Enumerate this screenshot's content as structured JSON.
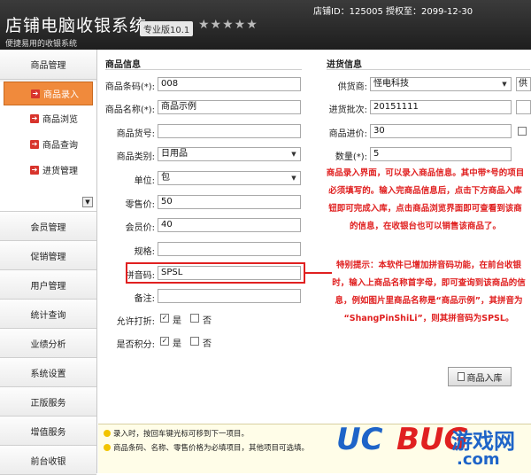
{
  "header": {
    "title": "店铺电脑收银系统",
    "subtitle": "便捷易用的收银系统",
    "edition": "专业版10.1",
    "stars": "★★★★★",
    "shop_info": "店铺ID：125005 授权至：2099-12-30"
  },
  "sidebar": {
    "groups": [
      "商品管理",
      "会员管理",
      "促销管理",
      "用户管理",
      "统计查询",
      "业绩分析",
      "系统设置",
      "正版服务",
      "增值服务",
      "前台收银"
    ],
    "sub_items": [
      "商品录入",
      "商品浏览",
      "商品查询",
      "进货管理"
    ]
  },
  "product_info": {
    "title": "商品信息",
    "fields": [
      {
        "label": "商品条码(*):",
        "value": "008"
      },
      {
        "label": "商品名称(*):",
        "value": "商品示例"
      },
      {
        "label": "商品货号:",
        "value": ""
      },
      {
        "label": "商品类别:",
        "value": "日用品"
      },
      {
        "label": "单位:",
        "value": "包"
      },
      {
        "label": "零售价:",
        "value": "50"
      },
      {
        "label": "会员价:",
        "value": "40"
      },
      {
        "label": "规格:",
        "value": ""
      },
      {
        "label": "拼音码:",
        "value": "SPSL"
      },
      {
        "label": "备注:",
        "value": ""
      }
    ],
    "allow_discount_label": "允许打折:",
    "allow_points_label": "是否积分:",
    "yes": "是",
    "no": "否"
  },
  "purchase_info": {
    "title": "进货信息",
    "fields": [
      {
        "label": "供货商:",
        "value": "怪电科技"
      },
      {
        "label": "进货批次:",
        "value": "20151111"
      },
      {
        "label": "商品进价:",
        "value": "30"
      },
      {
        "label": "数量(*):",
        "value": "5"
      }
    ],
    "side_button": "供"
  },
  "annotations": {
    "note1": [
      "商品录入界面，可以录入商品信息。其中带*号的项目",
      "必须填写的。输入完商品信息后，点击下方商品入库",
      "钮即可完成入库，点击商品浏览界面即可查看到该商",
      "的信息，在收银台也可以销售该商品了。"
    ],
    "note2": [
      "特别提示：本软件已增加拼音码功能，在前台收银",
      "时，输入上商品名称首字母，即可查询到该商品的信",
      "息，例如图片里商品名称是“商品示例”，其拼音为",
      "“ShangPinShiLi”，则其拼音码为SPSL。"
    ]
  },
  "submit_button": "商品入库",
  "tips": [
    "录入时，按回车键光标可移到下一项目。",
    "商品条码、名称、零售价格为必填项目，其他项目可选填。"
  ],
  "watermark": {
    "uc": "UC",
    "bug": "BUG",
    "cn": "游戏网",
    "com": ".com"
  },
  "colors": {
    "accent": "#f08a3c",
    "annotation": "#e02020",
    "header": "#2a2a2a"
  }
}
